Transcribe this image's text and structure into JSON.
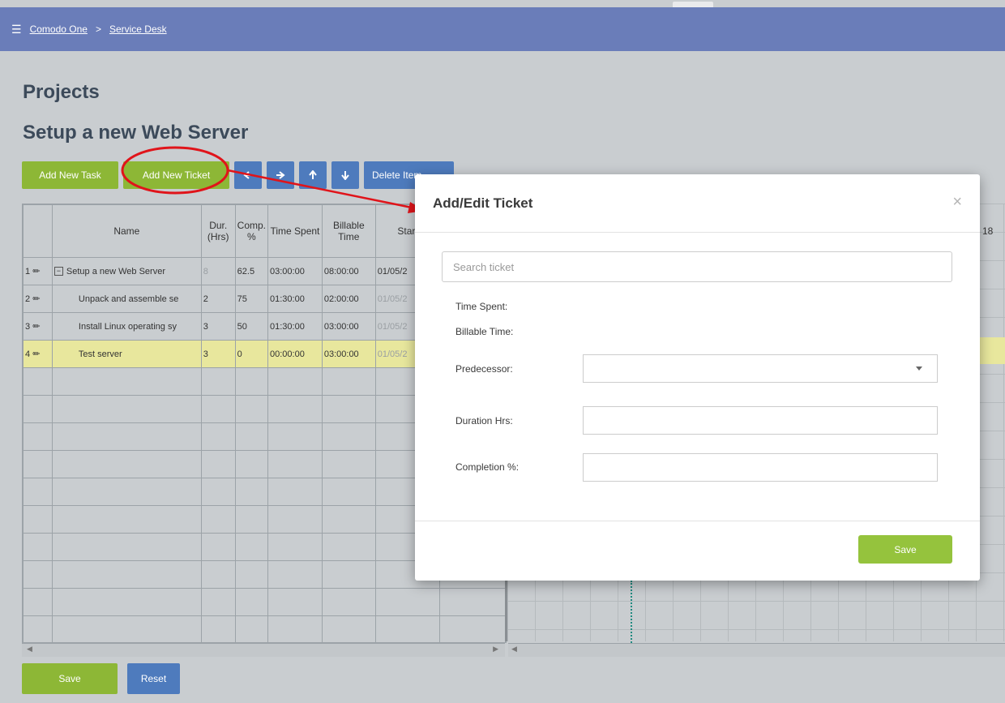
{
  "breadcrumb": {
    "root": "Comodo One",
    "separator": ">",
    "current": "Service Desk"
  },
  "page_title": "Projects",
  "project_title": "Setup a new Web Server",
  "toolbar": {
    "add_task": "Add New Task",
    "add_ticket": "Add New Ticket",
    "delete_item": "Delete Item",
    "icons": [
      "arrow-left-icon",
      "arrow-right-icon",
      "arrow-up-icon",
      "arrow-down-icon"
    ]
  },
  "grid": {
    "columns": [
      "Name",
      "Dur. (Hrs)",
      "Comp. %",
      "Time Spent",
      "Billable Time",
      "Start"
    ],
    "rows": [
      {
        "num": "1",
        "name": "Setup a new Web Server",
        "dur": "8",
        "comp": "62.5",
        "spent": "03:00:00",
        "billable": "08:00:00",
        "start": "01/05/2"
      },
      {
        "num": "2",
        "name": "Unpack and assemble se",
        "dur": "2",
        "comp": "75",
        "spent": "01:30:00",
        "billable": "02:00:00",
        "start": "01/05/2"
      },
      {
        "num": "3",
        "name": "Install Linux operating sy",
        "dur": "3",
        "comp": "50",
        "spent": "01:30:00",
        "billable": "03:00:00",
        "start": "01/05/2"
      },
      {
        "num": "4",
        "name": "Test server",
        "dur": "3",
        "comp": "0",
        "spent": "00:00:00",
        "billable": "03:00:00",
        "start": "01/05/2"
      }
    ]
  },
  "gantt": {
    "header_day": "18"
  },
  "bottom": {
    "save": "Save",
    "reset": "Reset"
  },
  "modal": {
    "title": "Add/Edit Ticket",
    "close_glyph": "×",
    "search_placeholder": "Search ticket",
    "time_spent_label": "Time Spent:",
    "billable_time_label": "Billable Time:",
    "predecessor_label": "Predecessor:",
    "duration_label": "Duration Hrs:",
    "completion_label": "Completion %:",
    "save": "Save"
  },
  "colors": {
    "topbar": "#6a7db9",
    "green_button": "#8db736",
    "blue_button": "#4e7bbd",
    "highlight_row": "#e8e79d",
    "annotation_red": "#e0141a"
  }
}
